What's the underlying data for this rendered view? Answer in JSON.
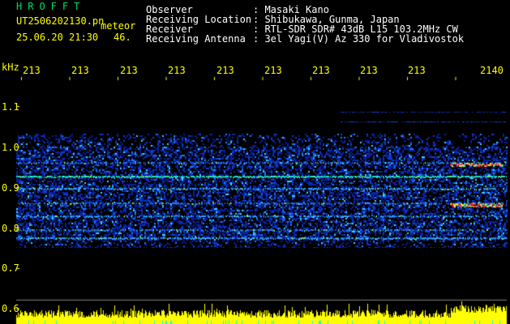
{
  "header": {
    "brand": "HROFFT",
    "filename": "UT2506202130.pn",
    "mode": "meteor",
    "datetime": "25.06.20 21:30",
    "count": "46.",
    "info": [
      {
        "label": "Observer",
        "value": ": Masaki Kano"
      },
      {
        "label": "Receiving Location",
        "value": ": Shibukawa, Gunma, Japan"
      },
      {
        "label": "Receiver",
        "value": ": RTL-SDR SDR# 43dB L15 103.2MHz CW"
      },
      {
        "label": "Receiving Antenna",
        "value": ": 3el Yagi(V) Az 330 for Vladivostok"
      }
    ]
  },
  "x_axis": {
    "labels": [
      "213",
      "213",
      "213",
      "213",
      "213",
      "213",
      "213",
      "213",
      "213",
      "2140"
    ]
  },
  "y_axis": {
    "unit": "kHz",
    "labels": [
      "1.1",
      "1.0",
      "0.9",
      "0.8",
      "0.7",
      "0.6"
    ]
  },
  "colors": {
    "background": "#000000",
    "text": "#ffff00",
    "header_text": "#ffffff",
    "brand": "#00e060",
    "noise": "#1030c0",
    "signal": "#00e0ff",
    "strong": "#ff2020",
    "meter": "#ffff00"
  }
}
